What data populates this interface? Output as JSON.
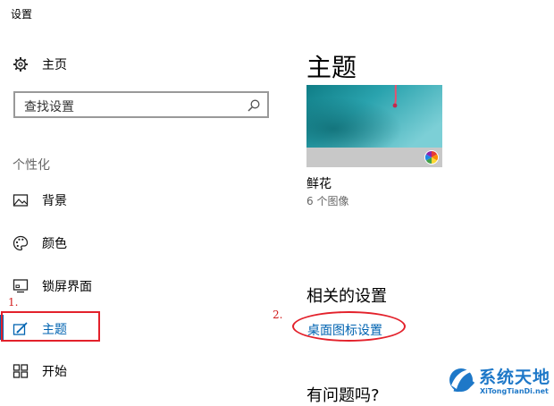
{
  "window": {
    "title": "设置"
  },
  "sidebar": {
    "home_label": "主页",
    "search_placeholder": "查找设置",
    "section_title": "个性化",
    "items": [
      {
        "label": "背景",
        "icon": "picture-icon"
      },
      {
        "label": "颜色",
        "icon": "palette-icon"
      },
      {
        "label": "锁屏界面",
        "icon": "lock-screen-icon"
      },
      {
        "label": "主题",
        "icon": "theme-pen-icon",
        "selected": true
      },
      {
        "label": "开始",
        "icon": "start-tiles-icon"
      }
    ]
  },
  "annotations": {
    "step1": "1.",
    "step2": "2."
  },
  "main": {
    "title": "主题",
    "theme": {
      "name": "鲜花",
      "count": "6 个图像"
    },
    "related": {
      "title": "相关的设置",
      "desktop_icon_link": "桌面图标设置"
    },
    "question_title": "有问题吗?"
  },
  "watermark": {
    "title": "系统天地",
    "subtitle": "XiTongTianDi.net"
  },
  "colors": {
    "accent": "#0063b1",
    "annotation": "#e3212b",
    "preview_bar": "#c8c8c8"
  }
}
